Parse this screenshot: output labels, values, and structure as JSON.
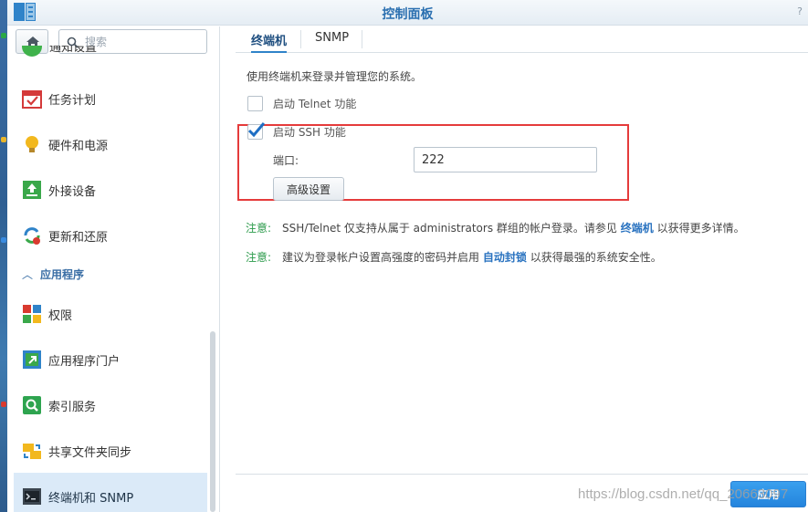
{
  "window": {
    "title": "控制面板",
    "help": "?"
  },
  "sidebar": {
    "search_placeholder": "搜索",
    "partial_item": "通知设置",
    "items": [
      {
        "label": "任务计划",
        "icon": "task-schedule-icon"
      },
      {
        "label": "硬件和电源",
        "icon": "hardware-power-icon"
      },
      {
        "label": "外接设备",
        "icon": "external-devices-icon"
      },
      {
        "label": "更新和还原",
        "icon": "update-restore-icon"
      }
    ],
    "section_header": "应用程序",
    "apps": [
      {
        "label": "权限",
        "icon": "privileges-icon"
      },
      {
        "label": "应用程序门户",
        "icon": "app-portal-icon"
      },
      {
        "label": "索引服务",
        "icon": "indexing-service-icon"
      },
      {
        "label": "共享文件夹同步",
        "icon": "shared-folder-sync-icon"
      },
      {
        "label": "终端机和 SNMP",
        "icon": "terminal-snmp-icon",
        "selected": true
      }
    ]
  },
  "tabs": [
    {
      "label": "终端机",
      "active": true
    },
    {
      "label": "SNMP",
      "active": false
    }
  ],
  "terminal": {
    "description": "使用终端机来登录并管理您的系统。",
    "telnet_label": "启动 Telnet 功能",
    "telnet_checked": false,
    "ssh_label": "启动 SSH 功能",
    "ssh_checked": true,
    "port_label": "端口:",
    "port_value": "222",
    "advanced_button": "高级设置",
    "note1": {
      "prefix": "注意:",
      "text_before": "SSH/Telnet 仅支持从属于 administrators 群组的帐户登录。请参见",
      "link": "终端机",
      "text_after": "以获得更多详情。"
    },
    "note2": {
      "prefix": "注意:",
      "text_before": "建议为登录帐户设置高强度的密码并启用",
      "link": "自动封锁",
      "text_after": "以获得最强的系统安全性。"
    }
  },
  "footer": {
    "apply_button": "应用"
  },
  "watermark": "https://blog.csdn.net/qq_20663097",
  "colors": {
    "accent": "#2f83c9",
    "highlight_box": "#e53b3b",
    "note_label": "#2a9a4a",
    "selected_bg": "#dbeaf8"
  }
}
